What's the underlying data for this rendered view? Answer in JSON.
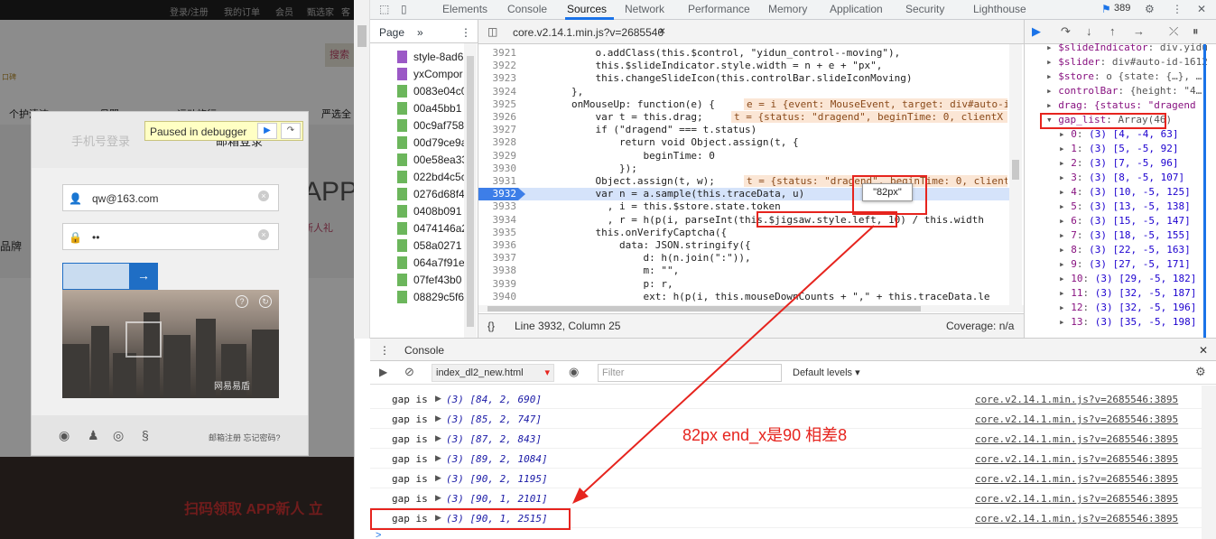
{
  "website": {
    "topbar_items": [
      "登录/注册",
      "我的订单",
      "会员",
      "甄选家",
      "客"
    ],
    "search_label": "搜索",
    "tag": "口碑",
    "nav_items": [
      "个护清洁",
      "母婴",
      "运动旅行",
      "严选全"
    ],
    "hero_big": "APP",
    "hero_sub": "新人礼",
    "hero_side": "品牌",
    "promo": "扫码领取 APP新人 立"
  },
  "login": {
    "tab_phone": "手机号登录",
    "tab_email": "邮箱登录",
    "email_value": "qw@163.com",
    "password_value": "••",
    "slider_arrow": "→",
    "captcha_brand": "网易易盾",
    "footer_links": "邮箱注册  忘记密码?"
  },
  "paused": {
    "text": "Paused in debugger",
    "resume_icon": "play-icon",
    "step_icon": "step-over-icon"
  },
  "devtools": {
    "tabs": [
      "Elements",
      "Console",
      "Sources",
      "Network",
      "Performance",
      "Memory",
      "Application",
      "Security",
      "Lighthouse"
    ],
    "active_tab": "Sources",
    "issue_count": "389",
    "navigator_tab": "Page",
    "navigator_more": "»",
    "files": [
      "style-8ad6",
      "yxCompor",
      "0083e04c0",
      "00a45bb1",
      "00c9af758",
      "00d79ce9a",
      "00e58ea33",
      "022bd4c5c",
      "0276d68f4",
      "0408b091",
      "0474146a2",
      "058a0271",
      "064a7f91e",
      "07fef43b0",
      "08829c5f6"
    ],
    "editor_tab": "core.v2.14.1.min.js?v=2685546",
    "editor_close": "×",
    "status_line": "Line 3932, Column 25",
    "coverage": "Coverage: n/a",
    "code_lines": [
      {
        "num": "3921",
        "text": "            o.addClass(this.$control, \"yidun_control--moving\"),"
      },
      {
        "num": "3922",
        "text": "            this.$slideIndicator.style.width = n + e + \"px\","
      },
      {
        "num": "3923",
        "text": "            this.changeSlideIcon(this.controlBar.slideIconMoving)"
      },
      {
        "num": "3924",
        "text": "        },"
      },
      {
        "num": "3925",
        "text": "        onMouseUp: function(e) {"
      },
      {
        "num": "3926",
        "text": "            var t = this.drag;"
      },
      {
        "num": "3927",
        "text": "            if (\"dragend\" === t.status)"
      },
      {
        "num": "3928",
        "text": "                return void Object.assign(t, {"
      },
      {
        "num": "3929",
        "text": "                    beginTime: 0"
      },
      {
        "num": "3930",
        "text": "                });"
      },
      {
        "num": "3931",
        "text": "            Object.assign(t, w);"
      },
      {
        "num": "3932",
        "text": "            var n = a.sample(this.traceData, u)"
      },
      {
        "num": "3933",
        "text": "              , i = this.$store.state.token"
      },
      {
        "num": "3934",
        "text": "              , r = h(p(i, parseInt(this.$jigsaw.style.left, 10) / this.width"
      },
      {
        "num": "3935",
        "text": "            this.onVerifyCaptcha({"
      },
      {
        "num": "3936",
        "text": "                data: JSON.stringify({"
      },
      {
        "num": "3937",
        "text": "                    d: h(n.join(\":\")),"
      },
      {
        "num": "3938",
        "text": "                    m: \"\","
      },
      {
        "num": "3939",
        "text": "                    p: r,"
      },
      {
        "num": "3940",
        "text": "                    ext: h(p(i, this.mouseDownCounts + \",\" + this.traceData.le"
      },
      {
        "num": "3941",
        "text": ""
      }
    ],
    "inline_values": {
      "e": "e = i {event: MouseEvent, target: div#auto-i",
      "t": "t = {status: \"dragend\", beginTime: 0, clientX",
      "w": "t = {status: \"dragend\", beginTime: 0, client"
    },
    "tooltip": "\"82px\"",
    "scope_lines": [
      {
        "exp": "▸",
        "key": "$slideIndicator",
        "val": "div.yidu"
      },
      {
        "exp": "▸",
        "key": "$slider",
        "val": "div#auto-id-1612"
      },
      {
        "exp": "▸",
        "key": "$store",
        "val": "o {state: {…}, …"
      },
      {
        "exp": "▸",
        "key": "controlBar",
        "val": "{height: \"4…"
      },
      {
        "exp": "▾",
        "key": "gap_list",
        "val": "Array(46)"
      },
      {
        "exp": "▸",
        "key": "0",
        "val": "(3) [4, -4, 63]"
      },
      {
        "exp": "▸",
        "key": "1",
        "val": "(3) [5, -5, 92]"
      },
      {
        "exp": "▸",
        "key": "2",
        "val": "(3) [7, -5, 96]"
      },
      {
        "exp": "▸",
        "key": "3",
        "val": "(3) [8, -5, 107]"
      },
      {
        "exp": "▸",
        "key": "4",
        "val": "(3) [10, -5, 125]"
      },
      {
        "exp": "▸",
        "key": "5",
        "val": "(3) [13, -5, 138]"
      },
      {
        "exp": "▸",
        "key": "6",
        "val": "(3) [15, -5, 147]"
      },
      {
        "exp": "▸",
        "key": "7",
        "val": "(3) [18, -5, 155]"
      },
      {
        "exp": "▸",
        "key": "8",
        "val": "(3) [22, -5, 163]"
      },
      {
        "exp": "▸",
        "key": "9",
        "val": "(3) [27, -5, 171]"
      },
      {
        "exp": "▸",
        "key": "10",
        "val": "(3) [29, -5, 182]"
      },
      {
        "exp": "▸",
        "key": "11",
        "val": "(3) [32, -5, 187]"
      },
      {
        "exp": "▸",
        "key": "12",
        "val": "(3) [32, -5, 196]"
      },
      {
        "exp": "▸",
        "key": "13",
        "val": "(3) [35, -5, 198]"
      }
    ],
    "drag_line": "drag: {status: \"dragend",
    "drawer_tab": "Console",
    "context": "index_dl2_new.html",
    "filter_placeholder": "Filter",
    "levels": "Default levels",
    "console_rows": [
      {
        "label": "gap is",
        "value": "(3) [84, 2, 690]",
        "src": "core.v2.14.1.min.js?v=2685546:3895"
      },
      {
        "label": "gap is",
        "value": "(3) [85, 2, 747]",
        "src": "core.v2.14.1.min.js?v=2685546:3895"
      },
      {
        "label": "gap is",
        "value": "(3) [87, 2, 843]",
        "src": "core.v2.14.1.min.js?v=2685546:3895"
      },
      {
        "label": "gap is",
        "value": "(3) [89, 2, 1084]",
        "src": "core.v2.14.1.min.js?v=2685546:3895"
      },
      {
        "label": "gap is",
        "value": "(3) [90, 2, 1195]",
        "src": "core.v2.14.1.min.js?v=2685546:3895"
      },
      {
        "label": "gap is",
        "value": "(3) [90, 1, 2101]",
        "src": "core.v2.14.1.min.js?v=2685546:3895"
      },
      {
        "label": "gap is",
        "value": "(3) [90, 1, 2515]",
        "src": "core.v2.14.1.min.js?v=2685546:3895"
      }
    ],
    "prompt": ">"
  },
  "annotation": {
    "note": "82px  end_x是90 相差8",
    "color": "#e6241e"
  }
}
